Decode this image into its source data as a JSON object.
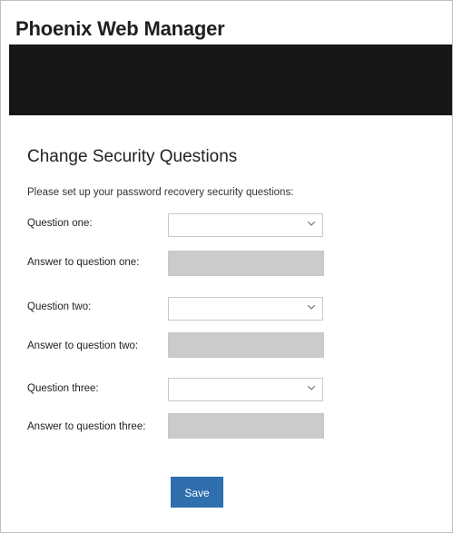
{
  "app": {
    "title": "Phoenix Web Manager"
  },
  "page": {
    "title": "Change Security Questions",
    "instructions": "Please set up your password recovery security questions:"
  },
  "form": {
    "question_one_label": "Question one:",
    "answer_one_label": "Answer to question one:",
    "question_two_label": "Question two:",
    "answer_two_label": "Answer to question two:",
    "question_three_label": "Question three:",
    "answer_three_label": "Answer to question three:",
    "question_one_value": "",
    "question_two_value": "",
    "question_three_value": "",
    "answer_one_value": "",
    "answer_two_value": "",
    "answer_three_value": ""
  },
  "actions": {
    "save_label": "Save"
  },
  "colors": {
    "banner": "#171717",
    "save_button": "#2f6fae",
    "disabled_answer_field": "#cbcbcb"
  },
  "icons": {
    "select_chevron": "chevron-down-icon"
  }
}
